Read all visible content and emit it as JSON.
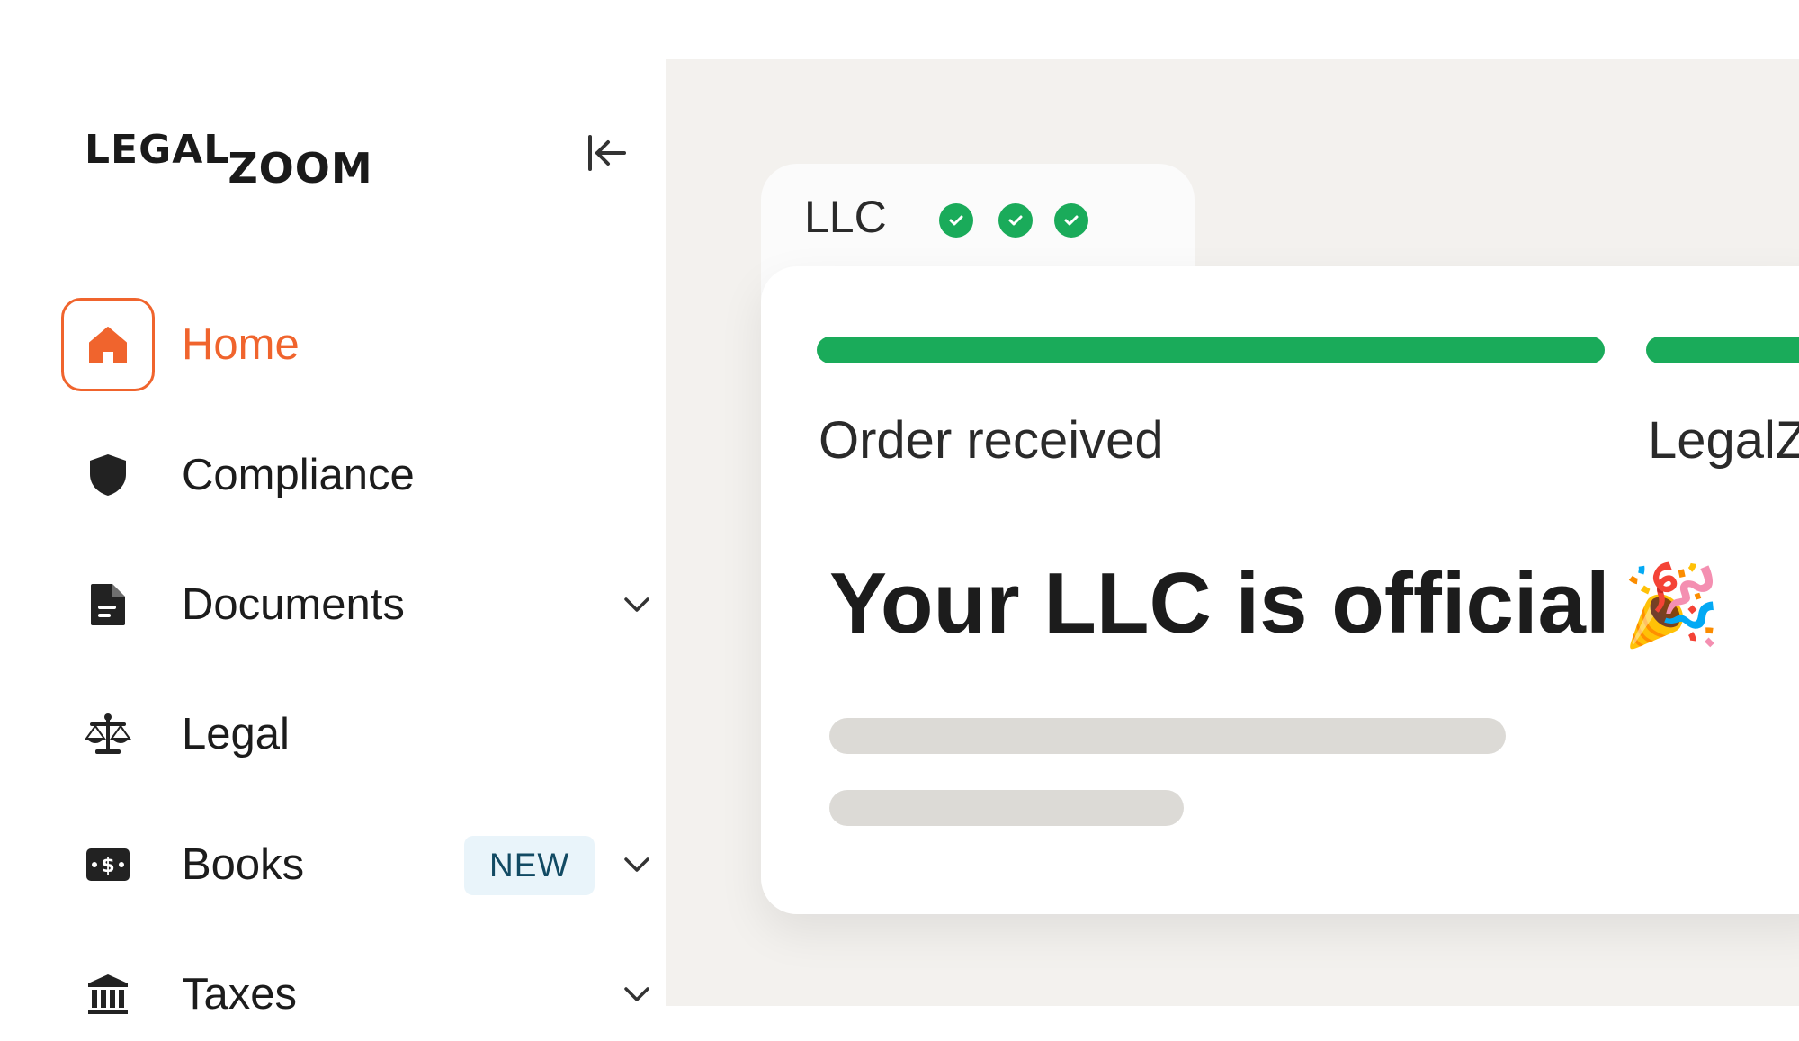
{
  "brand": {
    "logo_legal": "LEGAL",
    "logo_zoom": "ZOOM"
  },
  "sidebar": {
    "collapse_icon": "collapse-left-icon",
    "items": [
      {
        "label": "Home",
        "icon": "home-icon",
        "active": true
      },
      {
        "label": "Compliance",
        "icon": "shield-icon"
      },
      {
        "label": "Documents",
        "icon": "document-icon",
        "expandable": true
      },
      {
        "label": "Legal",
        "icon": "scales-icon"
      },
      {
        "label": "Books",
        "icon": "money-icon",
        "badge": "NEW",
        "expandable": true
      },
      {
        "label": "Taxes",
        "icon": "bank-icon",
        "expandable": true
      }
    ]
  },
  "main": {
    "tab": {
      "label": "LLC",
      "checks": 3
    },
    "card": {
      "steps": [
        {
          "label": "Order received",
          "progress": 1.0
        },
        {
          "label": "LegalZ",
          "progress": 1.0
        }
      ],
      "headline": "Your LLC is official",
      "headline_emoji": "🎉"
    }
  },
  "colors": {
    "accent": "#f0642d",
    "success": "#1aab5a",
    "badge_bg": "#e9f4fa",
    "badge_text": "#124a63",
    "main_bg": "#f3f1ee",
    "skeleton": "#dcdad6"
  }
}
